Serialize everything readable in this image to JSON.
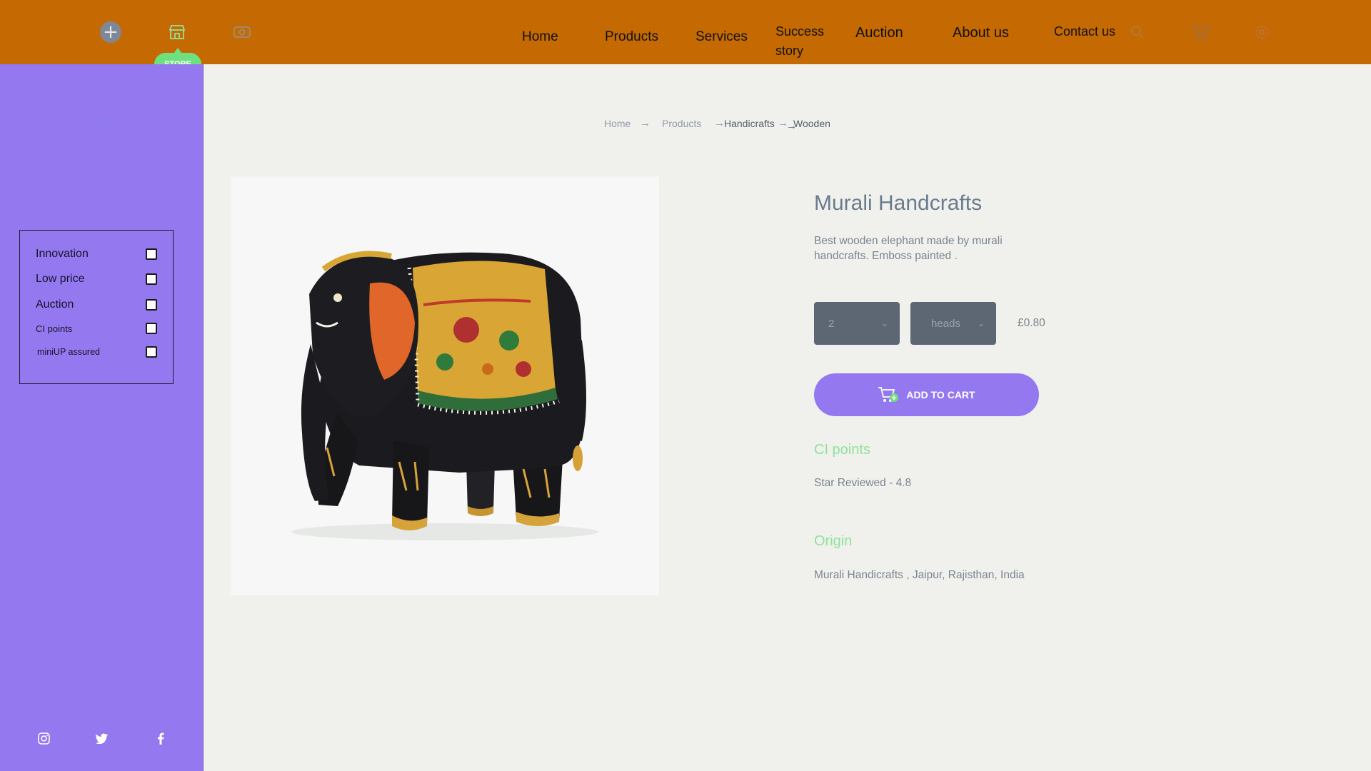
{
  "header": {
    "store_badge": "STORE",
    "nav": {
      "home": "Home",
      "products": "Products",
      "services": "Services",
      "success_line1": "Success",
      "success_line2": "story",
      "auction": "Auction",
      "about": "About us",
      "contact": "Contact us"
    },
    "icons": [
      "plus-icon",
      "store-icon",
      "currency-icon",
      "search-icon",
      "cart-icon",
      "settings-icon"
    ]
  },
  "sidebar": {
    "filters": [
      {
        "label": "Innovation"
      },
      {
        "label": "Low price"
      },
      {
        "label": "Auction"
      },
      {
        "label": "CI points"
      },
      {
        "label": "miniUP assured"
      }
    ],
    "social": [
      "instagram-icon",
      "twitter-icon",
      "facebook-icon"
    ]
  },
  "breadcrumb": {
    "home": "Home",
    "products": "Products",
    "handicrafts": "Handicrafts",
    "wooden": "Wooden"
  },
  "product": {
    "title": "Murali Handcrafts",
    "description": "Best wooden elephant made  by murali handcrafts. Emboss painted .",
    "quantity": "2",
    "unit": "heads",
    "price": "£0.80",
    "add_to_cart": "ADD TO CART",
    "ci_heading": "CI points",
    "rating_text": "Star Reviewed - 4.8",
    "origin_heading": "Origin",
    "origin_text": "Murali Handicrafts , Jaipur, Rajisthan, India"
  },
  "colors": {
    "header_bg": "#c56a03",
    "sidebar_bg": "#9478f0",
    "accent_green": "#8fe39a",
    "button": "#9478f0"
  }
}
